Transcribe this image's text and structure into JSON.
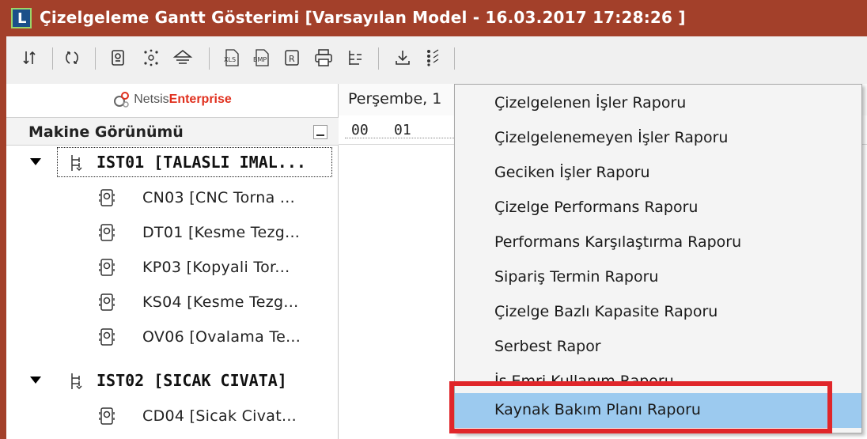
{
  "window": {
    "title": "Çizelgeleme Gantt Gösterimi [Varsayılan Model - 16.03.2017 17:28:26 ]",
    "app_icon_letter": "L"
  },
  "toolbar": {
    "buttons": [
      {
        "icon": "sort-icon"
      },
      {
        "icon": "refresh-icon"
      },
      {
        "icon": "machine-icon"
      },
      {
        "icon": "network-icon"
      },
      {
        "icon": "filter-icon"
      },
      {
        "icon": "excel-export-icon",
        "text": "XLS"
      },
      {
        "icon": "bmp-export-icon",
        "text": "BMP"
      },
      {
        "icon": "report-icon",
        "text": "R"
      },
      {
        "icon": "print-icon"
      },
      {
        "icon": "tree-report-icon"
      },
      {
        "icon": "download-icon"
      },
      {
        "icon": "list-options-icon"
      }
    ]
  },
  "left_panel": {
    "logo_netsis": "Netsis",
    "logo_enterprise": "Enterprise",
    "header": "Makine Görünümü",
    "groups": [
      {
        "label": "IST01 [TALASLI IMAL...",
        "expanded": true,
        "items": [
          {
            "label": "CN03 [CNC Torna ..."
          },
          {
            "label": "DT01 [Kesme Tezg..."
          },
          {
            "label": "KP03 [Kopyali Tor..."
          },
          {
            "label": "KS04 [Kesme Tezg..."
          },
          {
            "label": "OV06 [Ovalama Te..."
          }
        ]
      },
      {
        "label": "IST02 [SICAK CIVATA]",
        "expanded": true,
        "items": [
          {
            "label": "CD04 [Sicak Civat..."
          }
        ]
      }
    ]
  },
  "gantt": {
    "date_header": "Perşembe, 1",
    "hours": [
      "00",
      "01"
    ]
  },
  "context_menu": {
    "items": [
      {
        "label": "Çizelgelenen İşler Raporu"
      },
      {
        "label": "Çizelgelenemeyen İşler Raporu"
      },
      {
        "label": "Geciken İşler Raporu"
      },
      {
        "label": "Çizelge Performans Raporu"
      },
      {
        "label": "Performans Karşılaştırma Raporu"
      },
      {
        "label": "Sipariş Termin Raporu"
      },
      {
        "label": "Çizelge Bazlı Kapasite Raporu"
      },
      {
        "label": "Serbest Rapor"
      },
      {
        "label": "İş Emri Kullanım Raporu"
      },
      {
        "label": "Kaynak Bakım Planı Raporu",
        "highlighted": true
      }
    ],
    "highlight_color": "#9ccaef",
    "annotation_color": "#e0262a"
  },
  "colors": {
    "title_bar": "#a3402a",
    "toolbar_bg": "#f0f0f0"
  }
}
